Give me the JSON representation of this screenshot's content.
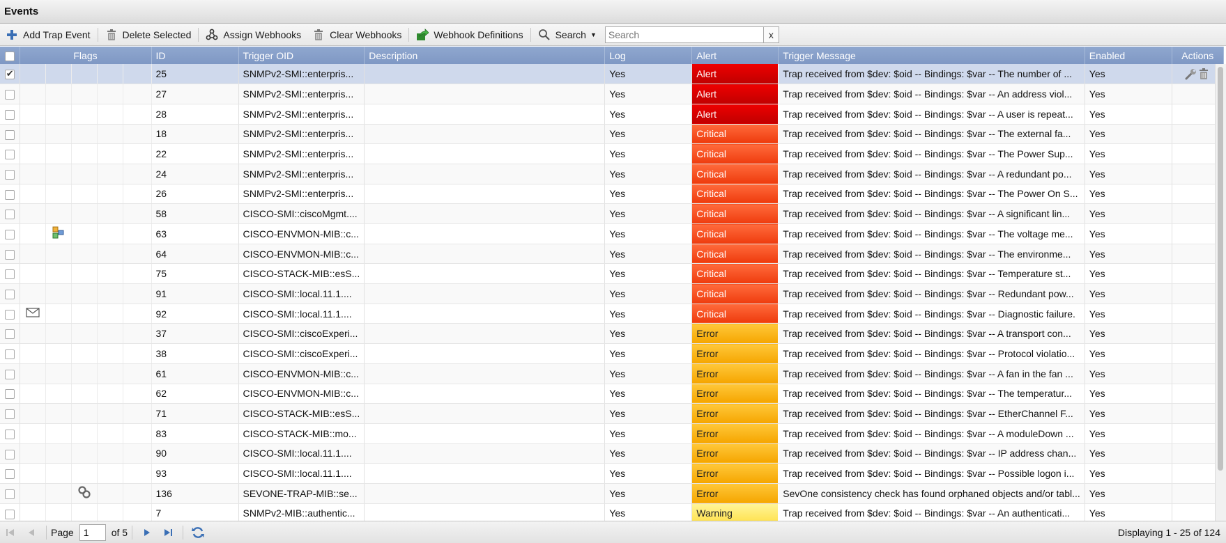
{
  "window": {
    "title": "Events"
  },
  "toolbar": {
    "add_trap_event": "Add Trap Event",
    "delete_selected": "Delete Selected",
    "assign_webhooks": "Assign Webhooks",
    "clear_webhooks": "Clear Webhooks",
    "webhook_definitions": "Webhook Definitions",
    "search_menu": "Search",
    "search_placeholder": "Search",
    "search_clear": "x"
  },
  "columns": {
    "flags": "Flags",
    "id": "ID",
    "trigger_oid": "Trigger OID",
    "description": "Description",
    "log": "Log",
    "alert": "Alert",
    "trigger_message": "Trigger Message",
    "enabled": "Enabled",
    "actions": "Actions"
  },
  "colors": {
    "header": "#8fa7cf",
    "selected_row": "#cfd9ec",
    "severity_alert": "#d40000",
    "severity_critical": "#f24b1c",
    "severity_error": "#f9b51c",
    "severity_warning": "#ffe866"
  },
  "rows": [
    {
      "checked": true,
      "flag": "",
      "id": "25",
      "oid": "SNMPv2-SMI::enterpris...",
      "description": "",
      "log": "Yes",
      "alert": "Alert",
      "severity": "alert",
      "message": "Trap received from $dev: $oid -- Bindings: $var -- The number of ...",
      "enabled": "Yes",
      "actions": [
        "wrench-icon",
        "trash-icon"
      ]
    },
    {
      "checked": false,
      "flag": "",
      "id": "27",
      "oid": "SNMPv2-SMI::enterpris...",
      "description": "",
      "log": "Yes",
      "alert": "Alert",
      "severity": "alert",
      "message": "Trap received from $dev: $oid -- Bindings: $var -- An address viol...",
      "enabled": "Yes",
      "actions": []
    },
    {
      "checked": false,
      "flag": "",
      "id": "28",
      "oid": "SNMPv2-SMI::enterpris...",
      "description": "",
      "log": "Yes",
      "alert": "Alert",
      "severity": "alert",
      "message": "Trap received from $dev: $oid -- Bindings: $var -- A user is repeat...",
      "enabled": "Yes",
      "actions": []
    },
    {
      "checked": false,
      "flag": "",
      "id": "18",
      "oid": "SNMPv2-SMI::enterpris...",
      "description": "",
      "log": "Yes",
      "alert": "Critical",
      "severity": "critical",
      "message": "Trap received from $dev: $oid -- Bindings: $var -- The external fa...",
      "enabled": "Yes",
      "actions": []
    },
    {
      "checked": false,
      "flag": "",
      "id": "22",
      "oid": "SNMPv2-SMI::enterpris...",
      "description": "",
      "log": "Yes",
      "alert": "Critical",
      "severity": "critical",
      "message": "Trap received from $dev: $oid -- Bindings: $var -- The Power Sup...",
      "enabled": "Yes",
      "actions": []
    },
    {
      "checked": false,
      "flag": "",
      "id": "24",
      "oid": "SNMPv2-SMI::enterpris...",
      "description": "",
      "log": "Yes",
      "alert": "Critical",
      "severity": "critical",
      "message": "Trap received from $dev: $oid -- Bindings: $var -- A redundant po...",
      "enabled": "Yes",
      "actions": []
    },
    {
      "checked": false,
      "flag": "",
      "id": "26",
      "oid": "SNMPv2-SMI::enterpris...",
      "description": "",
      "log": "Yes",
      "alert": "Critical",
      "severity": "critical",
      "message": "Trap received from $dev: $oid -- Bindings: $var -- The Power On S...",
      "enabled": "Yes",
      "actions": []
    },
    {
      "checked": false,
      "flag": "",
      "id": "58",
      "oid": "CISCO-SMI::ciscoMgmt....",
      "description": "",
      "log": "Yes",
      "alert": "Critical",
      "severity": "critical",
      "message": "Trap received from $dev: $oid -- Bindings: $var -- A significant lin...",
      "enabled": "Yes",
      "actions": []
    },
    {
      "checked": false,
      "flag": "policy",
      "id": "63",
      "oid": "CISCO-ENVMON-MIB::c...",
      "description": "",
      "log": "Yes",
      "alert": "Critical",
      "severity": "critical",
      "message": "Trap received from $dev: $oid -- Bindings: $var -- The voltage me...",
      "enabled": "Yes",
      "actions": []
    },
    {
      "checked": false,
      "flag": "",
      "id": "64",
      "oid": "CISCO-ENVMON-MIB::c...",
      "description": "",
      "log": "Yes",
      "alert": "Critical",
      "severity": "critical",
      "message": "Trap received from $dev: $oid -- Bindings: $var -- The environme...",
      "enabled": "Yes",
      "actions": []
    },
    {
      "checked": false,
      "flag": "",
      "id": "75",
      "oid": "CISCO-STACK-MIB::esS...",
      "description": "",
      "log": "Yes",
      "alert": "Critical",
      "severity": "critical",
      "message": "Trap received from $dev: $oid -- Bindings: $var -- Temperature st...",
      "enabled": "Yes",
      "actions": []
    },
    {
      "checked": false,
      "flag": "",
      "id": "91",
      "oid": "CISCO-SMI::local.11.1....",
      "description": "",
      "log": "Yes",
      "alert": "Critical",
      "severity": "critical",
      "message": "Trap received from $dev: $oid -- Bindings: $var -- Redundant pow...",
      "enabled": "Yes",
      "actions": []
    },
    {
      "checked": false,
      "flag": "mail",
      "id": "92",
      "oid": "CISCO-SMI::local.11.1....",
      "description": "",
      "log": "Yes",
      "alert": "Critical",
      "severity": "critical",
      "message": "Trap received from $dev: $oid -- Bindings: $var -- Diagnostic failure.",
      "enabled": "Yes",
      "actions": []
    },
    {
      "checked": false,
      "flag": "",
      "id": "37",
      "oid": "CISCO-SMI::ciscoExperi...",
      "description": "",
      "log": "Yes",
      "alert": "Error",
      "severity": "error",
      "message": "Trap received from $dev: $oid -- Bindings: $var -- A transport con...",
      "enabled": "Yes",
      "actions": []
    },
    {
      "checked": false,
      "flag": "",
      "id": "38",
      "oid": "CISCO-SMI::ciscoExperi...",
      "description": "",
      "log": "Yes",
      "alert": "Error",
      "severity": "error",
      "message": "Trap received from $dev: $oid -- Bindings: $var -- Protocol violatio...",
      "enabled": "Yes",
      "actions": []
    },
    {
      "checked": false,
      "flag": "",
      "id": "61",
      "oid": "CISCO-ENVMON-MIB::c...",
      "description": "",
      "log": "Yes",
      "alert": "Error",
      "severity": "error",
      "message": "Trap received from $dev: $oid -- Bindings: $var -- A fan in the fan ...",
      "enabled": "Yes",
      "actions": []
    },
    {
      "checked": false,
      "flag": "",
      "id": "62",
      "oid": "CISCO-ENVMON-MIB::c...",
      "description": "",
      "log": "Yes",
      "alert": "Error",
      "severity": "error",
      "message": "Trap received from $dev: $oid -- Bindings: $var -- The temperatur...",
      "enabled": "Yes",
      "actions": []
    },
    {
      "checked": false,
      "flag": "",
      "id": "71",
      "oid": "CISCO-STACK-MIB::esS...",
      "description": "",
      "log": "Yes",
      "alert": "Error",
      "severity": "error",
      "message": "Trap received from $dev: $oid -- Bindings: $var -- EtherChannel F...",
      "enabled": "Yes",
      "actions": []
    },
    {
      "checked": false,
      "flag": "",
      "id": "83",
      "oid": "CISCO-STACK-MIB::mo...",
      "description": "",
      "log": "Yes",
      "alert": "Error",
      "severity": "error",
      "message": "Trap received from $dev: $oid -- Bindings: $var -- A moduleDown ...",
      "enabled": "Yes",
      "actions": []
    },
    {
      "checked": false,
      "flag": "",
      "id": "90",
      "oid": "CISCO-SMI::local.11.1....",
      "description": "",
      "log": "Yes",
      "alert": "Error",
      "severity": "error",
      "message": "Trap received from $dev: $oid -- Bindings: $var -- IP address chan...",
      "enabled": "Yes",
      "actions": []
    },
    {
      "checked": false,
      "flag": "",
      "id": "93",
      "oid": "CISCO-SMI::local.11.1....",
      "description": "",
      "log": "Yes",
      "alert": "Error",
      "severity": "error",
      "message": "Trap received from $dev: $oid -- Bindings: $var -- Possible logon i...",
      "enabled": "Yes",
      "actions": []
    },
    {
      "checked": false,
      "flag": "webhook",
      "id": "136",
      "oid": "SEVONE-TRAP-MIB::se...",
      "description": "",
      "log": "Yes",
      "alert": "Error",
      "severity": "error",
      "message": "SevOne consistency check has found orphaned objects and/or tabl...",
      "enabled": "Yes",
      "actions": []
    },
    {
      "checked": false,
      "flag": "",
      "id": "7",
      "oid": "SNMPv2-MIB::authentic...",
      "description": "",
      "log": "Yes",
      "alert": "Warning",
      "severity": "warning",
      "message": "Trap received from $dev: $oid -- Bindings: $var -- An authenticati...",
      "enabled": "Yes",
      "actions": []
    }
  ],
  "pager": {
    "page_label": "Page",
    "page_value": "1",
    "of_pages": "of 5",
    "summary": "Displaying 1 - 25 of 124"
  }
}
